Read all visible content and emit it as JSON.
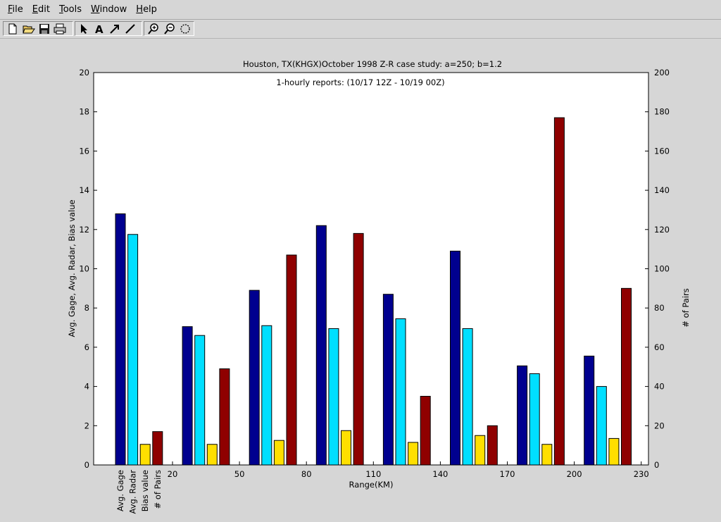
{
  "menu": [
    {
      "label": "File",
      "underline": "F",
      "rest": "ile"
    },
    {
      "label": "Edit",
      "underline": "E",
      "rest": "dit"
    },
    {
      "label": "Tools",
      "underline": "T",
      "rest": "ools"
    },
    {
      "label": "Window",
      "underline": "W",
      "rest": "indow"
    },
    {
      "label": "Help",
      "underline": "H",
      "rest": "elp"
    }
  ],
  "toolbar_icons": [
    "new-file-icon",
    "open-folder-icon",
    "save-icon",
    "print-icon",
    "select-arrow-icon",
    "text-tool-icon",
    "arrow-tool-icon",
    "line-tool-icon",
    "zoom-in-icon",
    "zoom-out-icon",
    "rotate-icon"
  ],
  "chart_data": {
    "type": "bar",
    "title": "Houston, TX(KHGX)October 1998 Z-R case study: a=250; b=1.2",
    "subtitle": "1-hourly reports: (10/17 12Z - 10/19 00Z)",
    "xlabel": "Range(KM)",
    "ylabel_left": "Avg. Gage, Avg. Radar, Bias value",
    "ylabel_right": "# of Pairs",
    "ylim_left": [
      0,
      20
    ],
    "ylim_right": [
      0,
      200
    ],
    "yticks_left": [
      0,
      2,
      4,
      6,
      8,
      10,
      12,
      14,
      16,
      18,
      20
    ],
    "yticks_right": [
      0,
      20,
      40,
      60,
      80,
      100,
      120,
      140,
      160,
      180,
      200
    ],
    "xticks": [
      "20",
      "50",
      "80",
      "110",
      "140",
      "170",
      "200",
      "230"
    ],
    "legend_labels": [
      "Avg. Gage",
      "Avg. Radar",
      "Bias value",
      "# of Pairs"
    ],
    "series": [
      {
        "name": "Avg. Gage",
        "axis": "left",
        "color": "#00008f",
        "values": [
          12.8,
          7.05,
          8.9,
          12.2,
          8.7,
          10.9,
          5.05,
          5.55
        ]
      },
      {
        "name": "Avg. Radar",
        "axis": "left",
        "color": "#00dfff",
        "values": [
          11.75,
          6.6,
          7.1,
          6.95,
          7.45,
          6.95,
          4.65,
          4.0
        ]
      },
      {
        "name": "Bias value",
        "axis": "left",
        "color": "#ffdf00",
        "values": [
          1.05,
          1.05,
          1.25,
          1.75,
          1.15,
          1.5,
          1.05,
          1.35
        ]
      },
      {
        "name": "# of Pairs",
        "axis": "right",
        "color": "#8f0000",
        "values": [
          17,
          49,
          107,
          118,
          35,
          20,
          177,
          90
        ]
      }
    ],
    "grid": false,
    "legend": "rotated labels below first group"
  }
}
